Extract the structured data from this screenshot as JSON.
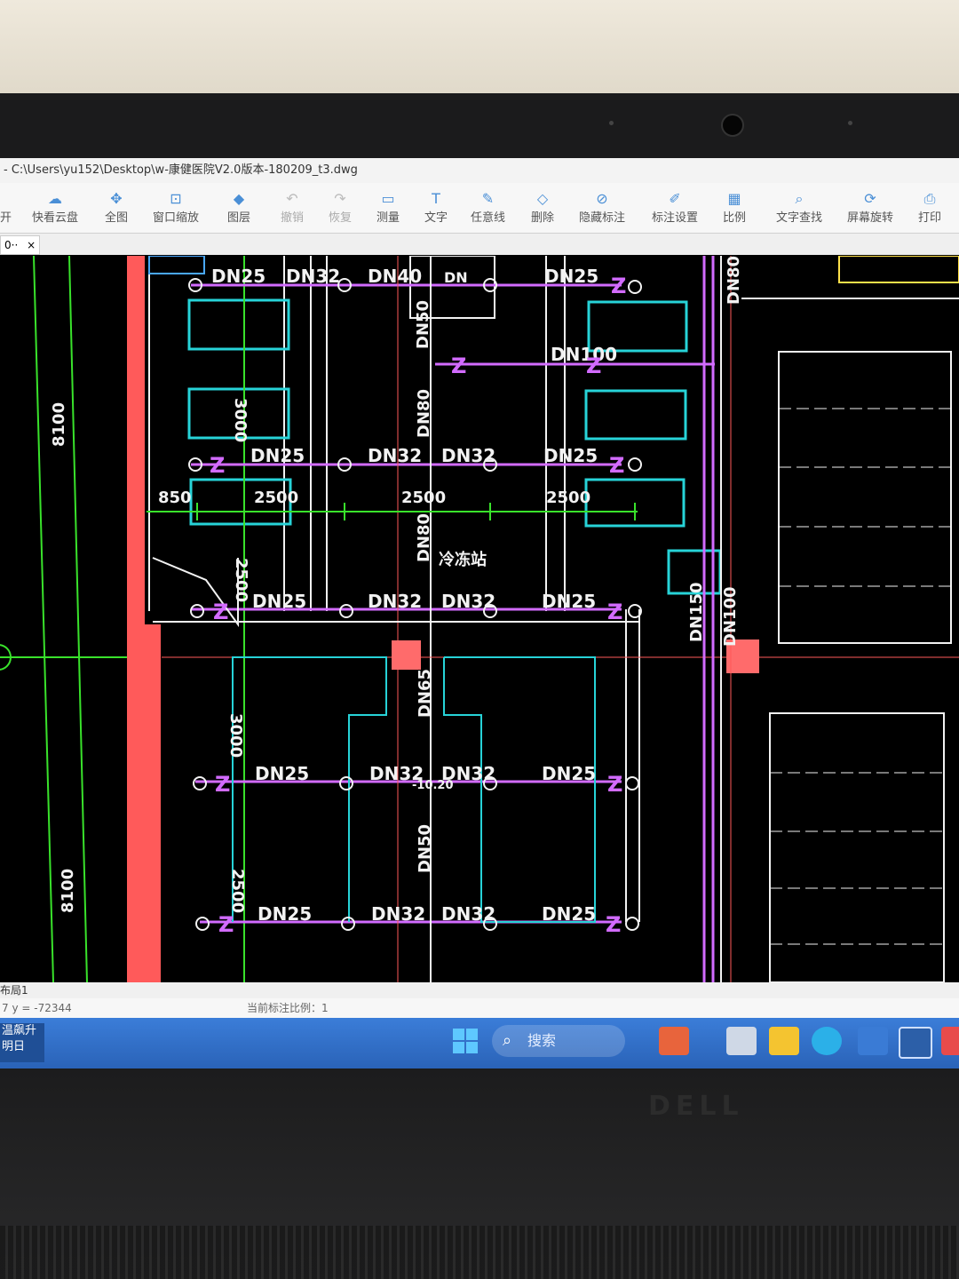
{
  "window": {
    "title": "- C:\\Users\\yu152\\Desktop\\w-康健医院V2.0版本-180209_t3.dwg"
  },
  "toolbar": {
    "items": [
      {
        "label": "开",
        "icon": "open-icon"
      },
      {
        "label": "快看云盘",
        "icon": "cloud-icon"
      },
      {
        "label": "全图",
        "icon": "fit-view-icon"
      },
      {
        "label": "窗口缩放",
        "icon": "zoom-window-icon"
      },
      {
        "label": "图层",
        "icon": "layers-icon"
      },
      {
        "label": "撤销",
        "icon": "undo-icon"
      },
      {
        "label": "恢复",
        "icon": "redo-icon"
      },
      {
        "label": "测量",
        "icon": "ruler-icon"
      },
      {
        "label": "文字",
        "icon": "text-icon"
      },
      {
        "label": "任意线",
        "icon": "pen-icon"
      },
      {
        "label": "删除",
        "icon": "eraser-icon"
      },
      {
        "label": "隐藏标注",
        "icon": "hide-annotation-icon"
      },
      {
        "label": "标注设置",
        "icon": "annotation-settings-icon"
      },
      {
        "label": "比例",
        "icon": "scale-icon"
      },
      {
        "label": "文字查找",
        "icon": "text-search-icon"
      },
      {
        "label": "屏幕旋转",
        "icon": "rotate-screen-icon"
      },
      {
        "label": "打印",
        "icon": "print-icon"
      }
    ]
  },
  "tab": {
    "label": "0··",
    "close": "×"
  },
  "layout_tab": "布局1",
  "status": {
    "coords": "7  y = -72344",
    "scale": "当前标注比例：1"
  },
  "drawing": {
    "pipe_labels": [
      "DN25",
      "DN32",
      "DN40",
      "DN25",
      "DN25",
      "DN32",
      "DN32",
      "DN25",
      "DN25",
      "DN32",
      "DN32",
      "DN25",
      "DN25",
      "DN32",
      "DN32",
      "DN25",
      "DN25",
      "DN32",
      "DN32",
      "DN25"
    ],
    "dn_labels": {
      "dn50a": "DN50",
      "dn80a": "DN80",
      "dn100": "DN100",
      "dn80b": "DN80",
      "dn65": "DN65",
      "dn50b": "DN50",
      "dn150": "DN150",
      "dn100v": "DN100",
      "dn80r": "DN80",
      "dn_valve": "DN"
    },
    "dimensions": {
      "d850": "850",
      "d2500a": "2500",
      "d2500b": "2500",
      "d2500c": "2500",
      "d2500v": "2500",
      "d3000a": "3000",
      "d3000b": "3000",
      "d2500w": "2500",
      "d8100a": "8100",
      "d8100b": "8100"
    },
    "z_marker": "Z",
    "station_label": "冷冻站",
    "elevation": "-10.20",
    "colors": {
      "cyan": "#27d3d8",
      "magenta": "#d26bff",
      "green": "#39e22b",
      "red": "#ff5555",
      "white": "#f2f2f2"
    }
  },
  "taskbar": {
    "weather_line1": "温飙升",
    "weather_line2": "明日",
    "search_placeholder": "搜索",
    "search_icon": "magnifier-icon"
  },
  "brand": "DELL"
}
